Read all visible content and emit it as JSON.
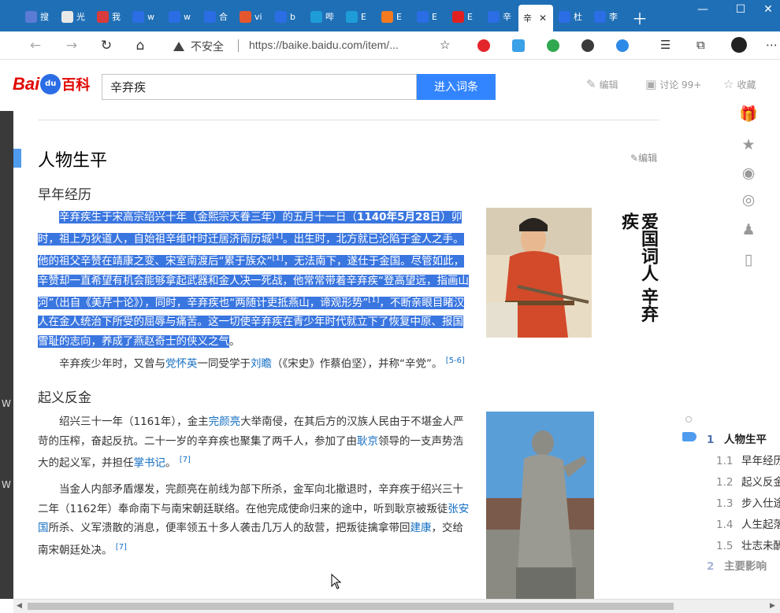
{
  "tabs": [
    {
      "label": "搜",
      "icon": "search-favicon",
      "color": "#5b7bd5"
    },
    {
      "label": "光",
      "icon": "page-favicon",
      "color": "#e8e8e8"
    },
    {
      "label": "我",
      "icon": "app-favicon",
      "color": "#d83b3b"
    },
    {
      "label": "w",
      "icon": "baidu-paw-favicon",
      "color": "#2b6de5"
    },
    {
      "label": "w",
      "icon": "baidu-paw-favicon",
      "color": "#2b6de5"
    },
    {
      "label": "合",
      "icon": "baidu-paw-favicon",
      "color": "#2b6de5"
    },
    {
      "label": "vi",
      "icon": "c-favicon",
      "color": "#e4572e"
    },
    {
      "label": "b",
      "icon": "baidu-paw-favicon",
      "color": "#2b6de5"
    },
    {
      "label": "哔",
      "icon": "bilibili-favicon",
      "color": "#1e9cd8"
    },
    {
      "label": "E",
      "icon": "bilibili-favicon",
      "color": "#1e9cd8"
    },
    {
      "label": "E",
      "icon": "chart-favicon",
      "color": "#f47a20"
    },
    {
      "label": "E",
      "icon": "baidu-paw-favicon",
      "color": "#2b6de5"
    },
    {
      "label": "E",
      "icon": "shop-favicon",
      "color": "#e02020"
    },
    {
      "label": "辛",
      "icon": "baidu-paw-favicon",
      "color": "#2b6de5"
    },
    {
      "label": "辛",
      "icon": "",
      "color": "#ffffff",
      "active": true
    },
    {
      "label": "杜",
      "icon": "baidu-paw-favicon",
      "color": "#2b6de5"
    },
    {
      "label": "李",
      "icon": "baidu-paw-favicon",
      "color": "#2b6de5"
    }
  ],
  "addressbar": {
    "security_text": "不安全",
    "url": "https://baike.baidu.com/item/..."
  },
  "header": {
    "logo_bai": "Bai",
    "logo_du": "du",
    "logo_baike": "百科",
    "search_value": "辛弃疾",
    "search_button": "进入词条",
    "edit_label": "编辑",
    "discuss_label": "讨论 99+",
    "collect_label": "收藏"
  },
  "section": {
    "title": "人物生平",
    "edit_label": "编辑"
  },
  "sub1": {
    "title": "早年经历",
    "para1": {
      "a": "辛弃疾生于宋高宗绍兴十年（金熙宗天眷三年）的五月十一日（",
      "b": "1140年5月28日",
      "c": "）卯时，祖上为狄道人，自始祖辛维叶时迁居济南历城",
      "ref1": "[1]",
      "d": "。出生时，北方就已沦陷于金人之手。他的祖父辛赞在靖康之变、宋室南渡后“累于族众”",
      "ref2": "[1]",
      "e": "，无法南下，遂仕于金国。尽管如此，辛赞却一直希望有机会能够拿起武器和金人决一死战，他常常带着辛弃疾“登高望远，指画山河”（出自《美芹十论》），同时，辛弃疾也“两随计吏抵燕山，谛观形势”",
      "ref3": "[1]",
      "f": "，不断亲眼目睹汉人在金人统治下所受的屈辱与痛苦。这一切使辛弃疾在青少年时代就立下了恢复中原、报国雪耻的志向，养成了燕赵奇士的侠义之气",
      "g": "。"
    },
    "para2": {
      "a": "辛弃疾少年时，又曾与",
      "link1": "党怀英",
      "b": "一同受学于",
      "link2": "刘瞻",
      "c": "（《宋史》作蔡伯坚），并称“辛党”。",
      "ref": "[5-6]"
    },
    "image_text": "爱国词人 辛弃疾"
  },
  "sub2": {
    "title": "起义反金",
    "para1": {
      "a": "绍兴三十一年（1161年），金主",
      "link1": "完颜亮",
      "b": "大举南侵，在其后方的汉族人民由于不堪金人严苛的压榨，奋起反抗。二十一岁的辛弃疾也聚集了两千人，参加了由",
      "link2": "耿京",
      "c": "领导的一支声势浩大的起义军，并担任",
      "link3": "掌书记",
      "d": "。",
      "ref": "[7]"
    },
    "para2": {
      "a": "当金人内部矛盾爆发，完颜亮在前线为部下所杀，金军向北撤退时，辛弃疾于绍兴三十二年（1162年）奉命南下与南宋朝廷联络。在他完成使命归来的途中，听到耿京被叛徒",
      "link1": "张安国",
      "b": "所杀、义军溃散的消息，便率领五十多人袭击几万人的敌营，把叛徒擒拿带回",
      "link2": "建康",
      "c": "，交给南宋朝廷处决。",
      "ref": "[7]"
    }
  },
  "toc": [
    {
      "num": "1",
      "label": "人物生平",
      "main": true
    },
    {
      "num": "1.1",
      "label": "早年经历"
    },
    {
      "num": "1.2",
      "label": "起义反金"
    },
    {
      "num": "1.3",
      "label": "步入仕途"
    },
    {
      "num": "1.4",
      "label": "人生起落"
    },
    {
      "num": "1.5",
      "label": "壮志未酬"
    },
    {
      "num": "2",
      "label": "主要影响",
      "main": true
    }
  ],
  "left_edge_letters": [
    "W",
    "W"
  ],
  "colors": {
    "tabbar": "#1f6fb6",
    "accent": "#3385ff",
    "selection": "#3a76e0",
    "link": "#136ec2",
    "section_bar": "#4f9cee"
  }
}
